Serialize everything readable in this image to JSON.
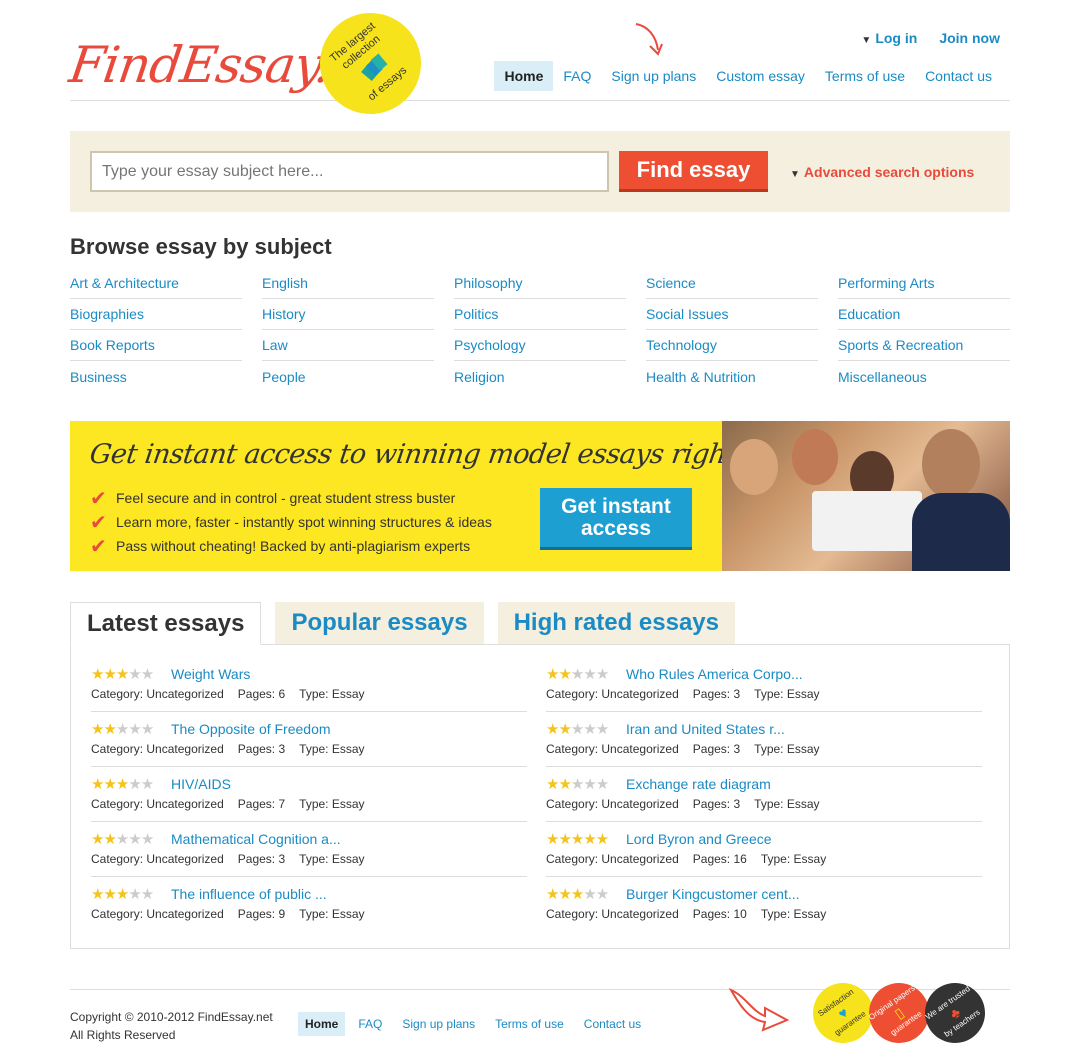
{
  "header": {
    "logo_text": "FindEssay.net",
    "badge_top": "The largest collection",
    "badge_bottom": "of essays",
    "login": "Log in",
    "join": "Join now",
    "nav": [
      "Home",
      "FAQ",
      "Sign up plans",
      "Custom essay",
      "Terms of use",
      "Contact us"
    ]
  },
  "search": {
    "placeholder": "Type your essay subject here...",
    "button": "Find essay",
    "advanced": "Advanced search options"
  },
  "browse": {
    "title": "Browse essay by subject",
    "columns": [
      [
        "Art & Architecture",
        "Biographies",
        "Book Reports",
        "Business"
      ],
      [
        "English",
        "History",
        "Law",
        "People"
      ],
      [
        "Philosophy",
        "Politics",
        "Psychology",
        "Religion"
      ],
      [
        "Science",
        "Social Issues",
        "Technology",
        "Health & Nutrition"
      ],
      [
        "Performing Arts",
        "Education",
        "Sports & Recreation",
        "Miscellaneous"
      ]
    ]
  },
  "promo": {
    "title": "Get instant access to winning model essays right now!",
    "points": [
      "Feel secure and in control - great student stress buster",
      "Learn more, faster - instantly spot winning structures & ideas",
      "Pass without cheating! Backed by anti-plagiarism experts"
    ],
    "button_line1": "Get instant",
    "button_line2": "access"
  },
  "tabs": [
    "Latest essays",
    "Popular essays",
    "High rated essays"
  ],
  "essay_labels": {
    "category": "Category:",
    "pages": "Pages:",
    "type": "Type:"
  },
  "essays_left": [
    {
      "title": "Weight Wars",
      "rating": 3,
      "category": "Uncategorized",
      "pages": "6",
      "type": "Essay"
    },
    {
      "title": "The Opposite of Freedom",
      "rating": 2,
      "category": "Uncategorized",
      "pages": "3",
      "type": "Essay"
    },
    {
      "title": "HIV/AIDS",
      "rating": 3,
      "category": "Uncategorized",
      "pages": "7",
      "type": "Essay"
    },
    {
      "title": "Mathematical Cognition a...",
      "rating": 2,
      "category": "Uncategorized",
      "pages": "3",
      "type": "Essay"
    },
    {
      "title": "The influence of public ...",
      "rating": 3,
      "category": "Uncategorized",
      "pages": "9",
      "type": "Essay"
    }
  ],
  "essays_right": [
    {
      "title": "Who Rules America Corpo...",
      "rating": 2,
      "category": "Uncategorized",
      "pages": "3",
      "type": "Essay"
    },
    {
      "title": "Iran and United States r...",
      "rating": 2,
      "category": "Uncategorized",
      "pages": "3",
      "type": "Essay"
    },
    {
      "title": "Exchange rate diagram",
      "rating": 2,
      "category": "Uncategorized",
      "pages": "3",
      "type": "Essay"
    },
    {
      "title": "Lord Byron and Greece",
      "rating": 5,
      "category": "Uncategorized",
      "pages": "16",
      "type": "Essay"
    },
    {
      "title": "Burger Kingcustomer cent...",
      "rating": 3,
      "category": "Uncategorized",
      "pages": "10",
      "type": "Essay"
    }
  ],
  "footer": {
    "copyright": "Copyright © 2010-2012 FindEssay.net",
    "rights": "All Rights Reserved",
    "nav": [
      "Home",
      "FAQ",
      "Sign up plans",
      "Terms of use",
      "Contact us"
    ],
    "seals": [
      {
        "top": "Satisfaction",
        "bottom": "guarantee"
      },
      {
        "top": "Original papers",
        "bottom": "guarantee"
      },
      {
        "top": "We are trusted",
        "bottom": "by teachers"
      }
    ]
  }
}
